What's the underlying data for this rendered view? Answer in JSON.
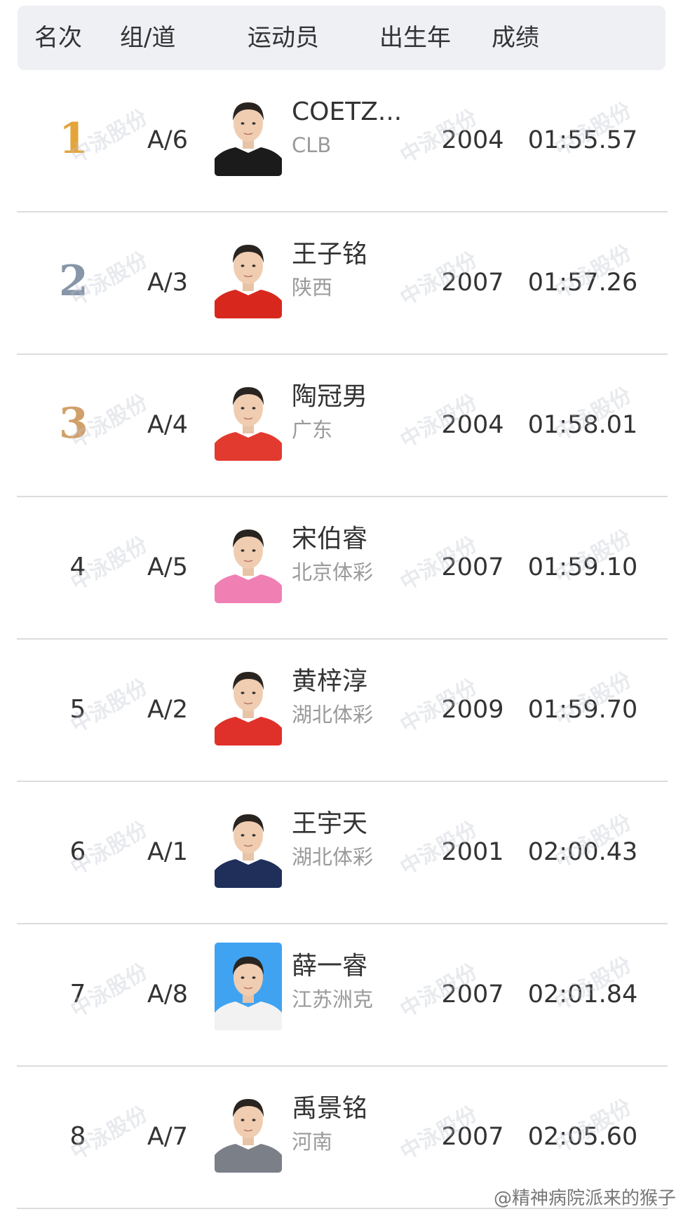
{
  "headers": {
    "rank": "名次",
    "lane": "组/道",
    "athlete": "运动员",
    "birth_year": "出生年",
    "result": "成绩"
  },
  "medal_colors": {
    "1": "#e4a43a",
    "2": "#8796a8",
    "3": "#d1a06a"
  },
  "rows": [
    {
      "rank": "1",
      "lane": "A/6",
      "name": "COETZ...",
      "team": "CLB",
      "year": "2004",
      "result": "01:55.57",
      "shirt": "#1b1b1b",
      "bg": "#ffffff"
    },
    {
      "rank": "2",
      "lane": "A/3",
      "name": "王子铭",
      "team": "陕西",
      "year": "2007",
      "result": "01:57.26",
      "shirt": "#d8281e",
      "bg": "#ffffff"
    },
    {
      "rank": "3",
      "lane": "A/4",
      "name": "陶冠男",
      "team": "广东",
      "year": "2004",
      "result": "01:58.01",
      "shirt": "#e23a2e",
      "bg": "#ffffff"
    },
    {
      "rank": "4",
      "lane": "A/5",
      "name": "宋伯睿",
      "team": "北京体彩",
      "year": "2007",
      "result": "01:59.10",
      "shirt": "#f07fb4",
      "bg": "#ffffff"
    },
    {
      "rank": "5",
      "lane": "A/2",
      "name": "黄梓淳",
      "team": "湖北体彩",
      "year": "2009",
      "result": "01:59.70",
      "shirt": "#e0302a",
      "bg": "#ffffff"
    },
    {
      "rank": "6",
      "lane": "A/1",
      "name": "王宇天",
      "team": "湖北体彩",
      "year": "2001",
      "result": "02:00.43",
      "shirt": "#1f2f5a",
      "bg": "#ffffff"
    },
    {
      "rank": "7",
      "lane": "A/8",
      "name": "薛一睿",
      "team": "江苏洲克",
      "year": "2007",
      "result": "02:01.84",
      "shirt": "#f2f2f2",
      "bg": "#3fa3f2"
    },
    {
      "rank": "8",
      "lane": "A/7",
      "name": "禹景铭",
      "team": "河南",
      "year": "2007",
      "result": "02:05.60",
      "shirt": "#7a7f88",
      "bg": "#ffffff"
    }
  ],
  "watermark": "中泳股份",
  "credit": "@精神病院派来的猴子"
}
